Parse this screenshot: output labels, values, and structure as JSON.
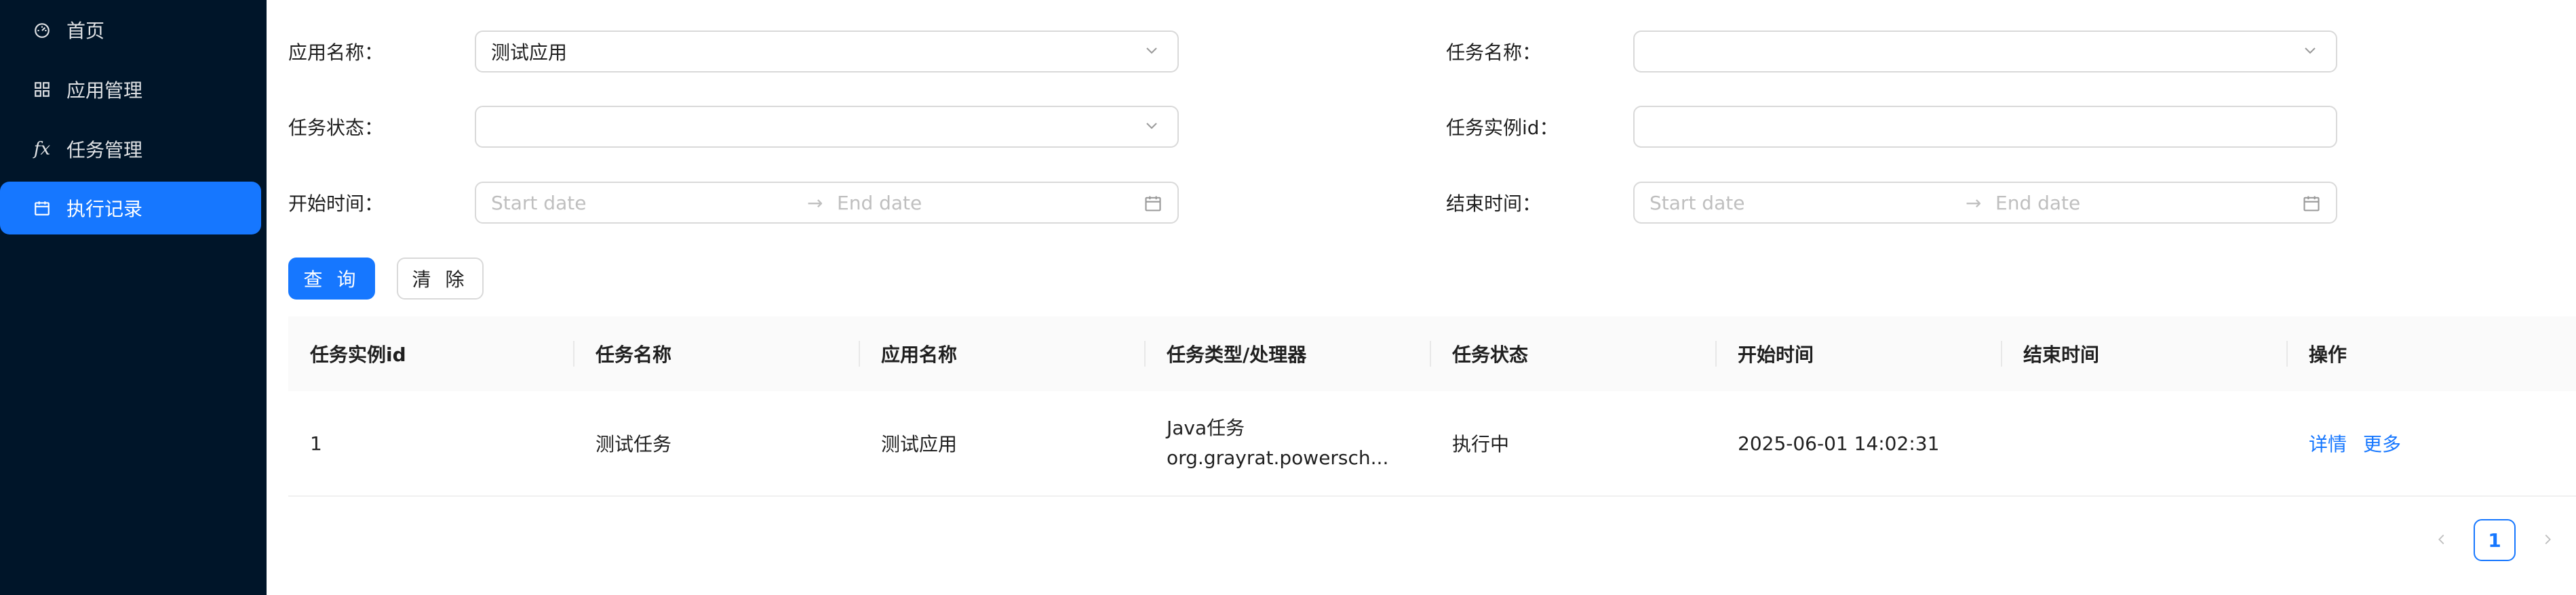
{
  "sidebar": {
    "items": [
      {
        "label": "首页",
        "icon": "dashboard-icon"
      },
      {
        "label": "应用管理",
        "icon": "grid-icon"
      },
      {
        "label": "任务管理",
        "icon": "fx-icon"
      },
      {
        "label": "执行记录",
        "icon": "calendar-icon",
        "active": true
      }
    ]
  },
  "filters": {
    "app_name_label": "应用名称：",
    "app_name_value": "测试应用",
    "task_name_label": "任务名称：",
    "task_name_value": "",
    "task_status_label": "任务状态：",
    "task_status_value": "",
    "instance_id_label": "任务实例id：",
    "instance_id_value": "",
    "start_time_label": "开始时间：",
    "end_time_label": "结束时间：",
    "start_placeholder": "Start date",
    "end_placeholder": "End date",
    "range_separator": "→"
  },
  "actions": {
    "query_label": "查 询",
    "clear_label": "清 除"
  },
  "table": {
    "columns": [
      "任务实例id",
      "任务名称",
      "应用名称",
      "任务类型/处理器",
      "任务状态",
      "开始时间",
      "结束时间",
      "操作"
    ],
    "rows": [
      {
        "instance_id": "1",
        "task_name": "测试任务",
        "app_name": "测试应用",
        "task_type": "Java任务",
        "processor": "org.grayrat.powersch...",
        "status": "执行中",
        "start_time": "2025-06-01 14:02:31",
        "end_time": "",
        "detail_link": "详情",
        "more_link": "更多"
      }
    ]
  },
  "pagination": {
    "current_page": "1"
  },
  "colors": {
    "sidebar_bg": "#001529",
    "accent": "#1677ff"
  }
}
